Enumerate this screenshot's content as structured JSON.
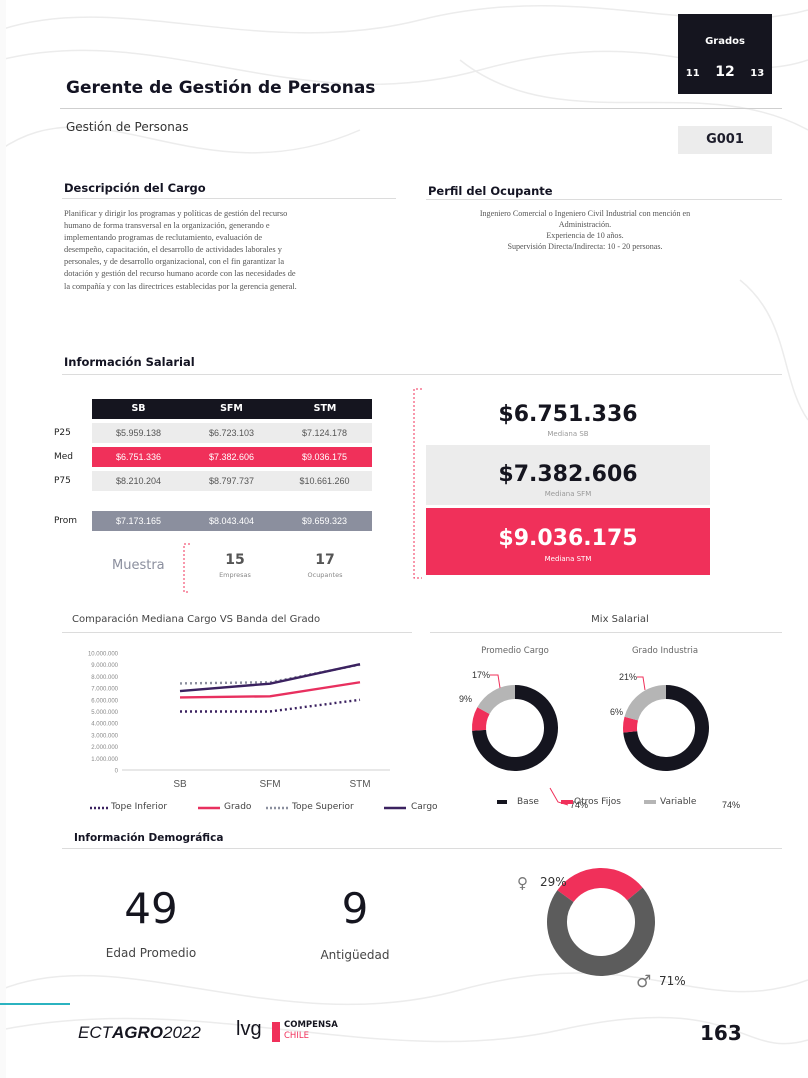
{
  "header": {
    "title": "Gerente de Gestión de Personas",
    "area": "Gestión de Personas",
    "grados_label": "Grados",
    "grados": [
      "11",
      "12",
      "13"
    ],
    "code": "G001"
  },
  "descripcion": {
    "heading": "Descripción del Cargo",
    "lines": [
      "Planificar y dirigir los programas y políticas de gestión del recurso",
      "humano de forma transversal en la organización, generando e",
      "implementando programas de reclutamiento, evaluación de",
      "desempeño, capacitación, el desarrollo de actividades laborales y",
      "personales, y de desarrollo organizacional, con el fin garantizar la",
      "dotación y gestión del recurso humano acorde con las necesidades de",
      "la compañía y con las directrices establecidas por la gerencia general."
    ]
  },
  "perfil": {
    "heading": "Perfil del Ocupante",
    "lines": [
      "Ingeniero Comercial o Ingeniero Civil Industrial con mención en",
      "Administración.",
      "Experiencia de 10 años.",
      "Supervisión Directa/Indirecta: 10 - 20 personas."
    ]
  },
  "salarial": {
    "heading": "Información Salarial",
    "columns": [
      "SB",
      "SFM",
      "STM"
    ],
    "rows": [
      {
        "label": "P25",
        "values": [
          "$5.959.138",
          "$6.723.103",
          "$7.124.178"
        ]
      },
      {
        "label": "Med",
        "values": [
          "$6.751.336",
          "$7.382.606",
          "$9.036.175"
        ]
      },
      {
        "label": "P75",
        "values": [
          "$8.210.204",
          "$8.797.737",
          "$10.661.260"
        ]
      },
      {
        "label": "Prom",
        "values": [
          "$7.173.165",
          "$8.043.404",
          "$9.659.323"
        ]
      }
    ],
    "muestra_label": "Muestra",
    "empresas_value": "15",
    "empresas_label": "Empresas",
    "ocupantes_value": "17",
    "ocupantes_label": "Ocupantes",
    "medianas": [
      {
        "value": "$6.751.336",
        "caption": "Mediana SB"
      },
      {
        "value": "$7.382.606",
        "caption": "Mediana SFM"
      },
      {
        "value": "$9.036.175",
        "caption": "Mediana STM"
      }
    ]
  },
  "colors": {
    "dark": "#15151f",
    "red": "#f0305a",
    "gray": "#8b8f9e",
    "light_gray": "#ececec",
    "dark_purple": "#3b2260",
    "pink": "#e8305f"
  },
  "chart_data": [
    {
      "type": "line",
      "title": "Comparación Mediana Cargo VS Banda del Grado",
      "categories": [
        "SB",
        "SFM",
        "STM"
      ],
      "ylim": [
        0,
        10000000
      ],
      "yticks": [
        "0",
        "1.000.000",
        "2.000.000",
        "3.000.000",
        "4.000.000",
        "5.000.000",
        "6.000.000",
        "7.000.000",
        "8.000.000",
        "9.000.000",
        "10.000.000"
      ],
      "series": [
        {
          "name": "Tope Inferior",
          "values": [
            5000000,
            5000000,
            6000000
          ],
          "color": "#3b2260",
          "dash": "2,3"
        },
        {
          "name": "Grado",
          "values": [
            6200000,
            6300000,
            7500000
          ],
          "color": "#e8305f",
          "dash": ""
        },
        {
          "name": "Tope Superior",
          "values": [
            7400000,
            7500000,
            9000000
          ],
          "color": "#8b8f9e",
          "dash": "2,3"
        },
        {
          "name": "Cargo",
          "values": [
            6750000,
            7380000,
            9040000
          ],
          "color": "#3b2260",
          "dash": ""
        }
      ]
    },
    {
      "type": "pie",
      "title": "Mix Salarial",
      "subcharts": [
        {
          "name": "Promedio Cargo",
          "categories": [
            "Base",
            "Otros Fijos",
            "Variable"
          ],
          "values": [
            74,
            9,
            17
          ],
          "labels": [
            "74%",
            "9%",
            "17%"
          ]
        },
        {
          "name": "Grado Industria",
          "categories": [
            "Base",
            "Otros Fijos",
            "Variable"
          ],
          "values": [
            74,
            6,
            21
          ],
          "labels": [
            "74%",
            "6%",
            "21%"
          ]
        }
      ],
      "legend": [
        "Base",
        "Otros Fijos",
        "Variable"
      ]
    },
    {
      "type": "pie",
      "categories": [
        "Mujer",
        "Hombre"
      ],
      "values": [
        29,
        71
      ],
      "labels": [
        "29%",
        "71%"
      ]
    }
  ],
  "demografica": {
    "heading": "Información Demográfica",
    "edad_value": "49",
    "edad_label": "Edad Promedio",
    "antiguedad_value": "9",
    "antiguedad_label": "Antigüedad"
  },
  "footer": {
    "brand_prefix": "ECT",
    "brand_bold": "AGRO",
    "brand_year": "2022",
    "logo_lvg": "lvg",
    "logo_compensa": "COMPENSA",
    "logo_chile": "CHILE",
    "page_number": "163"
  }
}
